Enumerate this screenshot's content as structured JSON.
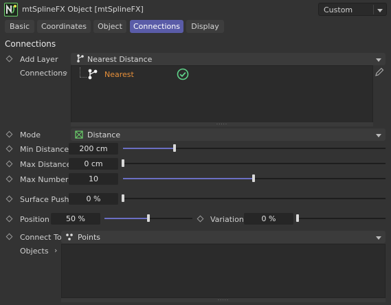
{
  "window": {
    "title": "mtSplineFX Object [mtSplineFX]"
  },
  "preset": {
    "value": "Custom"
  },
  "tabs": [
    {
      "label": "Basic"
    },
    {
      "label": "Coordinates"
    },
    {
      "label": "Object"
    },
    {
      "label": "Connections",
      "active": true
    },
    {
      "label": "Display"
    }
  ],
  "section": {
    "title": "Connections"
  },
  "add_layer": {
    "label": "Add Layer",
    "value": "Nearest Distance"
  },
  "connections": {
    "label": "Connections",
    "items": [
      {
        "name": "Nearest",
        "enabled": true,
        "color": "#e8903a"
      }
    ]
  },
  "mode": {
    "label": "Mode",
    "value": "Distance"
  },
  "min_distance": {
    "label": "Min Distance",
    "value": "200 cm",
    "slider": 0.2
  },
  "max_distance": {
    "label": "Max Distance",
    "value": "0 cm",
    "slider": 0.0
  },
  "max_number": {
    "label": "Max Number",
    "value": "10",
    "slider": 0.5
  },
  "surface_push": {
    "label": "Surface Push",
    "value": "0 %",
    "slider": 0.0
  },
  "position": {
    "label": "Position",
    "value": "50 %",
    "slider": 0.5
  },
  "variation": {
    "label": "Variation",
    "value": "0 %",
    "slider": 0.0
  },
  "connect_to": {
    "label": "Connect To",
    "value": "Points"
  },
  "objects": {
    "label": "Objects"
  },
  "colors": {
    "accent": "#5a5ca8",
    "slider_fill": "#6b6fc4",
    "check": "#5fd48a",
    "background": "#333333"
  }
}
